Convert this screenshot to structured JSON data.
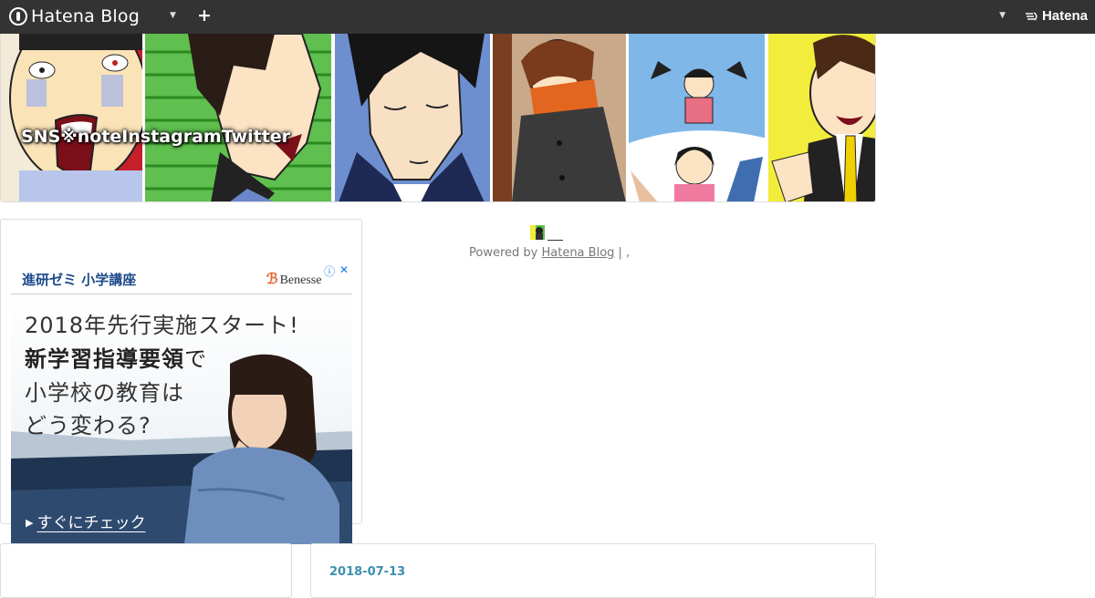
{
  "globalheader": {
    "logo_text": "Hatena Blog",
    "brand_text": "Hatena",
    "icons": [
      "hatena-blog-logo-icon",
      "chevron-down-icon",
      "plus-icon",
      "hatena-wings-icon"
    ]
  },
  "header": {
    "blog_title": "SNS※noteInstagramTwitter"
  },
  "ad": {
    "header_title": "進研ゼミ 小学講座",
    "header_brand": "Benesse",
    "info_icon": "ⓘ",
    "close_icon": "✕",
    "line1": "2018年先行実施スタート!",
    "line2_bold": "新学習指導要領",
    "line2_suffix": "で",
    "line3": "小学校の教育は",
    "line4": "どう変わる?",
    "cta": "すぐにチェック"
  },
  "footer": {
    "powered_prefix": "Powered by ",
    "powered_link": "Hatena Blog",
    "powered_suffix": " | ,"
  },
  "entry": {
    "date": "2018-07-13"
  },
  "colors": {
    "header_bg": "#333333",
    "date_link": "#3d8fb0",
    "ad_title": "#1d4a8a",
    "benesse_orange": "#e8632a"
  }
}
